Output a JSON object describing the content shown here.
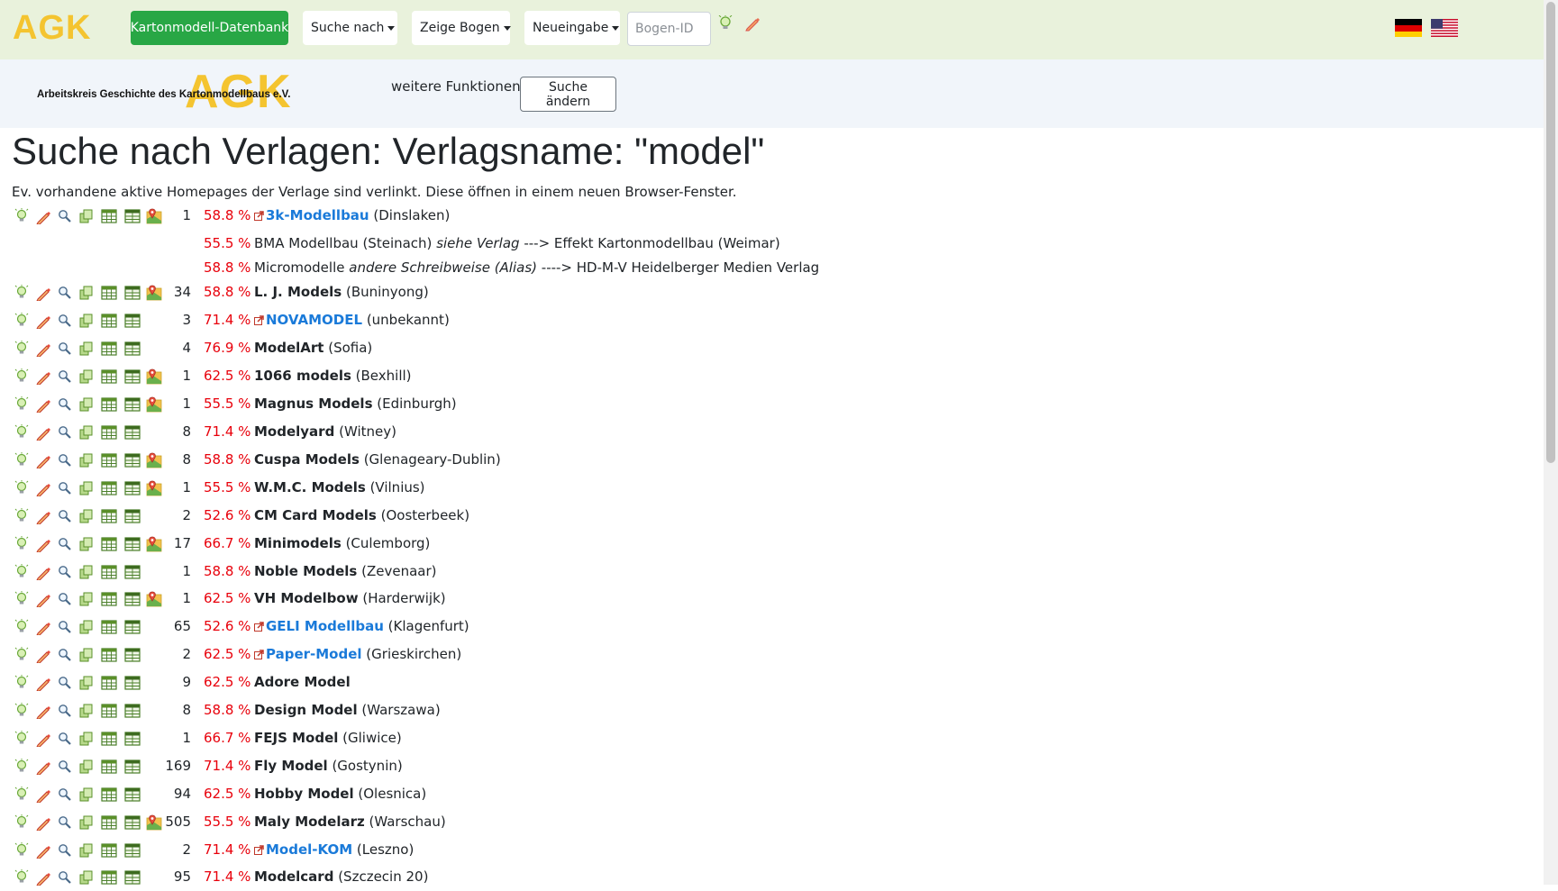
{
  "nav": {
    "logo": "AGK",
    "db_button": "Kartonmodell-Datenbank",
    "suche_nach": "Suche nach",
    "zeige_bogen": "Zeige Bogen",
    "neueingabe": "Neueingabe",
    "bogen_placeholder": "Bogen-ID",
    "languages": [
      "de-flag",
      "us-flag"
    ]
  },
  "subheader": {
    "logo_text": "Arbeitskreis Geschichte des Kartonmodellbaus e.V.",
    "logo_agk": "AGK",
    "weitere_label": "weitere Funktionen:",
    "suche_aendern": "Suche ändern"
  },
  "page": {
    "title": "Suche nach Verlagen: Verlagsname: \"model\"",
    "intro": "Ev. vorhandene aktive Homepages der Verlage sind verlinkt. Diese öffnen in einem neuen Browser-Fenster."
  },
  "colors": {
    "accent_green": "#28a745",
    "percent_red": "#e8000b",
    "link_blue": "#1a7ad9",
    "logo_gold": "#f4c430"
  },
  "results": [
    {
      "icons": true,
      "map": true,
      "count": "1",
      "pct": "58.8 %",
      "ext": true,
      "name": "3k-Modellbau",
      "place": "(Dinslaken)"
    },
    {
      "icons": false,
      "pct": "55.5 %",
      "alias": true,
      "name": "BMA Modellbau (Steinach)",
      "relation": "siehe Verlag",
      "arrow": "--->",
      "target": "Effekt Kartonmodellbau (Weimar)"
    },
    {
      "icons": false,
      "pct": "58.8 %",
      "alias": true,
      "name": "Micromodelle",
      "relation": "andere Schreibweise (Alias)",
      "arrow": "---->",
      "target": "HD-M-V Heidelberger Medien Verlag"
    },
    {
      "icons": true,
      "map": true,
      "count": "34",
      "pct": "58.8 %",
      "ext": false,
      "name": "L. J. Models",
      "place": "(Buninyong)"
    },
    {
      "icons": true,
      "map": false,
      "count": "3",
      "pct": "71.4 %",
      "ext": true,
      "name": "NOVAMODEL",
      "place": "(unbekannt)"
    },
    {
      "icons": true,
      "map": false,
      "count": "4",
      "pct": "76.9 %",
      "ext": false,
      "name": "ModelArt",
      "place": "(Sofia)"
    },
    {
      "icons": true,
      "map": true,
      "count": "1",
      "pct": "62.5 %",
      "ext": false,
      "name": "1066 models",
      "place": "(Bexhill)"
    },
    {
      "icons": true,
      "map": true,
      "count": "1",
      "pct": "55.5 %",
      "ext": false,
      "name": "Magnus Models",
      "place": "(Edinburgh)"
    },
    {
      "icons": true,
      "map": false,
      "count": "8",
      "pct": "71.4 %",
      "ext": false,
      "name": "Modelyard",
      "place": "(Witney)"
    },
    {
      "icons": true,
      "map": true,
      "count": "8",
      "pct": "58.8 %",
      "ext": false,
      "name": "Cuspa Models",
      "place": "(Glenageary-Dublin)"
    },
    {
      "icons": true,
      "map": true,
      "count": "1",
      "pct": "55.5 %",
      "ext": false,
      "name": "W.M.C. Models",
      "place": "(Vilnius)"
    },
    {
      "icons": true,
      "map": false,
      "count": "2",
      "pct": "52.6 %",
      "ext": false,
      "name": "CM Card Models",
      "place": "(Oosterbeek)"
    },
    {
      "icons": true,
      "map": true,
      "count": "17",
      "pct": "66.7 %",
      "ext": false,
      "name": "Minimodels",
      "place": "(Culemborg)"
    },
    {
      "icons": true,
      "map": false,
      "count": "1",
      "pct": "58.8 %",
      "ext": false,
      "name": "Noble Models",
      "place": "(Zevenaar)"
    },
    {
      "icons": true,
      "map": true,
      "count": "1",
      "pct": "62.5 %",
      "ext": false,
      "name": "VH Modelbow",
      "place": "(Harderwijk)"
    },
    {
      "icons": true,
      "map": false,
      "count": "65",
      "pct": "52.6 %",
      "ext": true,
      "name": "GELI Modellbau",
      "place": "(Klagenfurt)"
    },
    {
      "icons": true,
      "map": false,
      "count": "2",
      "pct": "62.5 %",
      "ext": true,
      "name": "Paper-Model",
      "place": "(Grieskirchen)"
    },
    {
      "icons": true,
      "map": false,
      "count": "9",
      "pct": "62.5 %",
      "ext": false,
      "name": "Adore Model",
      "place": ""
    },
    {
      "icons": true,
      "map": false,
      "count": "8",
      "pct": "58.8 %",
      "ext": false,
      "name": "Design Model",
      "place": "(Warszawa)"
    },
    {
      "icons": true,
      "map": false,
      "count": "1",
      "pct": "66.7 %",
      "ext": false,
      "name": "FEJS Model",
      "place": "(Gliwice)"
    },
    {
      "icons": true,
      "map": false,
      "count": "169",
      "pct": "71.4 %",
      "ext": false,
      "name": "Fly Model",
      "place": "(Gostynin)"
    },
    {
      "icons": true,
      "map": false,
      "count": "94",
      "pct": "62.5 %",
      "ext": false,
      "name": "Hobby Model",
      "place": "(Olesnica)"
    },
    {
      "icons": true,
      "map": true,
      "count": "505",
      "pct": "55.5 %",
      "ext": false,
      "name": "Maly Modelarz",
      "place": "(Warschau)"
    },
    {
      "icons": true,
      "map": false,
      "count": "2",
      "pct": "71.4 %",
      "ext": true,
      "name": "Model-KOM",
      "place": "(Leszno)"
    },
    {
      "icons": true,
      "map": false,
      "count": "95",
      "pct": "71.4 %",
      "ext": false,
      "name": "Modelcard",
      "place": "(Szczecin 20)"
    }
  ]
}
